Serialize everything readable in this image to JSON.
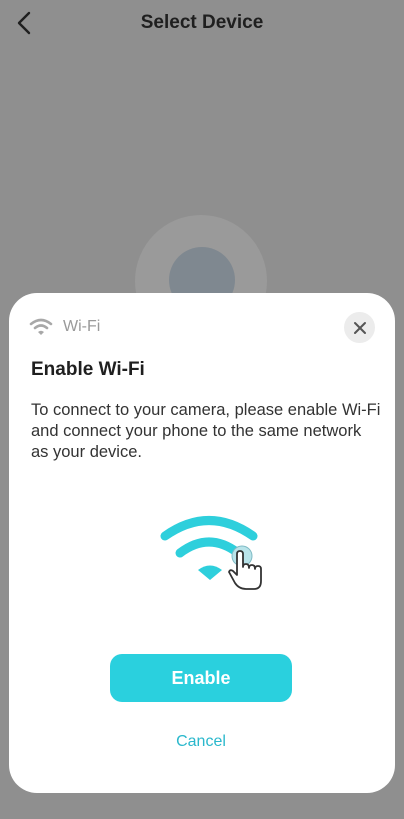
{
  "nav": {
    "title": "Select Device",
    "back_icon": "chevron-left-icon"
  },
  "sheet": {
    "header_icon": "wifi-icon",
    "header_label": "Wi-Fi",
    "close_icon": "close-icon",
    "title": "Enable Wi-Fi",
    "description": "To connect to your camera, please enable Wi-Fi and connect your phone to the same network as your device.",
    "illustration_icon": "wifi-tap-icon",
    "enable_label": "Enable",
    "cancel_label": "Cancel"
  },
  "colors": {
    "accent": "#2ad0de",
    "cancel_text": "#2ab8cc",
    "overlay": "#8f8f8f"
  }
}
